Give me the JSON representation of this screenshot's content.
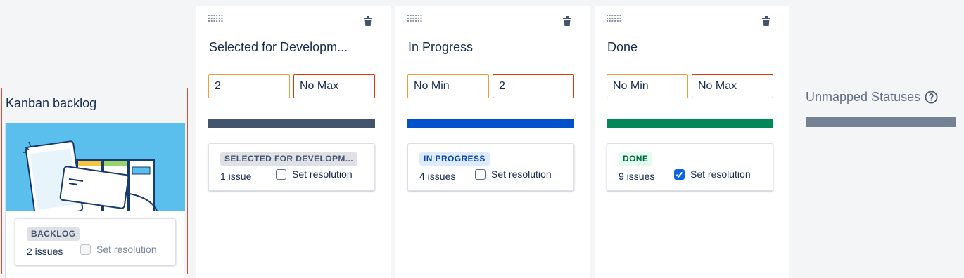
{
  "backlog": {
    "title": "Kanban backlog",
    "lozenge": "BACKLOG",
    "count": "2 issues",
    "resolution_label": "Set resolution",
    "resolution_checked": false,
    "resolution_disabled": true
  },
  "columns": [
    {
      "title": "Selected for Developm...",
      "min_value": "2",
      "max_value": "No Max",
      "bar_color": "#44546f",
      "lozenge": "SELECTED FOR DEVELOPM...",
      "lozenge_bg": "#dfe1e6",
      "lozenge_color": "#44546f",
      "count": "1 issue",
      "resolution_label": "Set resolution",
      "resolution_checked": false
    },
    {
      "title": "In Progress",
      "min_value": "No Min",
      "max_value": "2",
      "bar_color": "#0052cc",
      "lozenge": "IN PROGRESS",
      "lozenge_bg": "#deebff",
      "lozenge_color": "#0747a6",
      "count": "4 issues",
      "resolution_label": "Set resolution",
      "resolution_checked": false
    },
    {
      "title": "Done",
      "min_value": "No Min",
      "max_value": "No Max",
      "bar_color": "#00875a",
      "lozenge": "DONE",
      "lozenge_bg": "#e3fcef",
      "lozenge_color": "#006644",
      "count": "9 issues",
      "resolution_label": "Set resolution",
      "resolution_checked": true
    }
  ],
  "unmapped": {
    "title": "Unmapped Statuses",
    "bar_color": "#758195"
  },
  "icons": {
    "drag": "drag-handle-icon",
    "delete": "trash-icon",
    "help": "help-icon"
  }
}
